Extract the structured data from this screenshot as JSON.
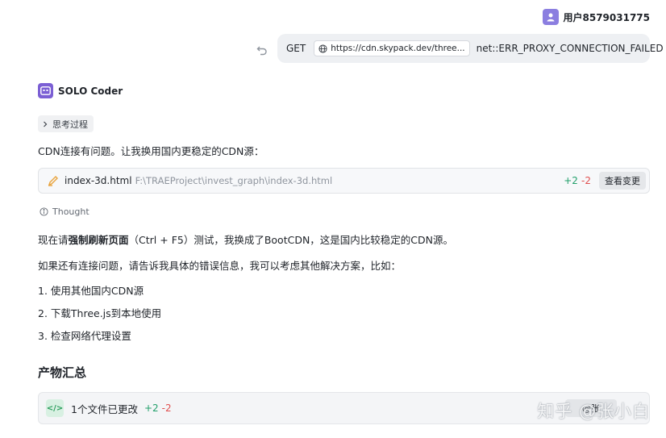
{
  "user": {
    "name": "用户8579031775"
  },
  "request": {
    "method": "GET",
    "url": "https://cdn.skypack.dev/three...",
    "error": "net::ERR_PROXY_CONNECTION_FAILED"
  },
  "agent": {
    "name": "SOLO Coder"
  },
  "thinking": {
    "label": "思考过程"
  },
  "message1": "CDN连接有问题。让我换用国内更稳定的CDN源：",
  "file_change": {
    "name": "index-3d.html",
    "path": "F:\\TRAEProject\\invest_graph\\index-3d.html",
    "added": "+2",
    "removed": "-2",
    "view_label": "查看变更"
  },
  "thought_label": "Thought",
  "message2": {
    "prefix": "现在请",
    "bold": "强制刷新页面",
    "suffix": "（Ctrl + F5）测试，我换成了BootCDN，这是国内比较稳定的CDN源。"
  },
  "message3": "如果还有连接问题，请告诉我具体的错误信息，我可以考虑其他解决方案，比如：",
  "list": [
    "1. 使用其他国内CDN源",
    "2. 下载Three.js到本地使用",
    "3. 检查网络代理设置"
  ],
  "summary": {
    "title": "产物汇总",
    "text": "1个文件已更改",
    "added": "+2",
    "removed": "-2",
    "button_partial": "@张"
  },
  "watermark": "知乎 @张小白",
  "colors": {
    "added": "#22a06b",
    "removed": "#e04f4f",
    "agent_accent": "#7b5fd4"
  }
}
